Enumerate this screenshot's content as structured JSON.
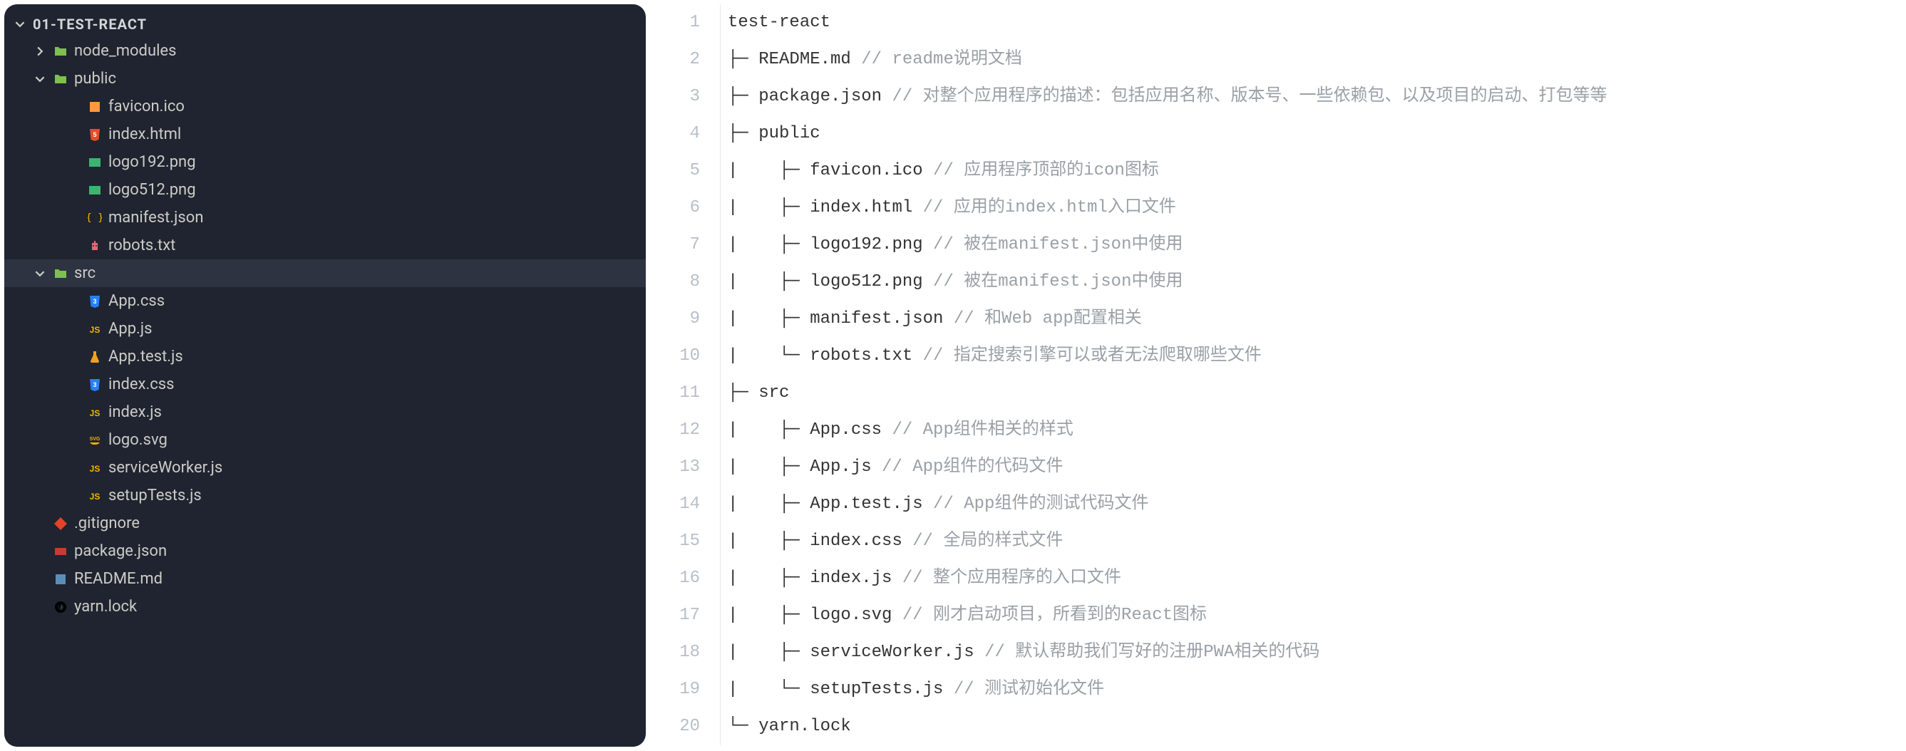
{
  "sidebar": {
    "root": "01-TEST-REACT",
    "tree": [
      {
        "id": "node_modules",
        "label": "node_modules",
        "depth": 1,
        "icon": "folder-green",
        "chevron": "right",
        "selected": false
      },
      {
        "id": "public",
        "label": "public",
        "depth": 1,
        "icon": "folder-green",
        "chevron": "down",
        "selected": false
      },
      {
        "id": "favicon",
        "label": "favicon.ico",
        "depth": 2,
        "icon": "orange",
        "chevron": "",
        "selected": false
      },
      {
        "id": "index-html",
        "label": "index.html",
        "depth": 2,
        "icon": "html",
        "chevron": "",
        "selected": false
      },
      {
        "id": "logo192",
        "label": "logo192.png",
        "depth": 2,
        "icon": "img",
        "chevron": "",
        "selected": false
      },
      {
        "id": "logo512",
        "label": "logo512.png",
        "depth": 2,
        "icon": "img",
        "chevron": "",
        "selected": false
      },
      {
        "id": "manifest",
        "label": "manifest.json",
        "depth": 2,
        "icon": "json",
        "chevron": "",
        "selected": false
      },
      {
        "id": "robots",
        "label": "robots.txt",
        "depth": 2,
        "icon": "robot",
        "chevron": "",
        "selected": false
      },
      {
        "id": "src",
        "label": "src",
        "depth": 1,
        "icon": "folder-green",
        "chevron": "down",
        "selected": true
      },
      {
        "id": "app-css",
        "label": "App.css",
        "depth": 2,
        "icon": "css",
        "chevron": "",
        "selected": false
      },
      {
        "id": "app-js",
        "label": "App.js",
        "depth": 2,
        "icon": "js",
        "chevron": "",
        "selected": false
      },
      {
        "id": "app-test",
        "label": "App.test.js",
        "depth": 2,
        "icon": "test",
        "chevron": "",
        "selected": false
      },
      {
        "id": "index-css",
        "label": "index.css",
        "depth": 2,
        "icon": "css",
        "chevron": "",
        "selected": false
      },
      {
        "id": "index-js",
        "label": "index.js",
        "depth": 2,
        "icon": "js",
        "chevron": "",
        "selected": false
      },
      {
        "id": "logo-svg",
        "label": "logo.svg",
        "depth": 2,
        "icon": "svg",
        "chevron": "",
        "selected": false
      },
      {
        "id": "sw",
        "label": "serviceWorker.js",
        "depth": 2,
        "icon": "js",
        "chevron": "",
        "selected": false
      },
      {
        "id": "setup",
        "label": "setupTests.js",
        "depth": 2,
        "icon": "js",
        "chevron": "",
        "selected": false
      },
      {
        "id": "gitignore",
        "label": ".gitignore",
        "depth": 1,
        "icon": "git",
        "chevron": "",
        "selected": false
      },
      {
        "id": "package",
        "label": "package.json",
        "depth": 1,
        "icon": "npm",
        "chevron": "",
        "selected": false
      },
      {
        "id": "readme",
        "label": "README.md",
        "depth": 1,
        "icon": "readme",
        "chevron": "",
        "selected": false
      },
      {
        "id": "yarn",
        "label": "yarn.lock",
        "depth": 1,
        "icon": "yarn",
        "chevron": "",
        "selected": false
      }
    ]
  },
  "code": {
    "lines": [
      {
        "n": 1,
        "text": "test-react",
        "comment": ""
      },
      {
        "n": 2,
        "text": "├─ README.md ",
        "comment": "// readme说明文档"
      },
      {
        "n": 3,
        "text": "├─ package.json ",
        "comment": "// 对整个应用程序的描述：包括应用名称、版本号、一些依赖包、以及项目的启动、打包等等"
      },
      {
        "n": 4,
        "text": "├─ public",
        "comment": ""
      },
      {
        "n": 5,
        "text": "|    ├─ favicon.ico ",
        "comment": "// 应用程序顶部的icon图标"
      },
      {
        "n": 6,
        "text": "|    ├─ index.html ",
        "comment": "// 应用的index.html入口文件"
      },
      {
        "n": 7,
        "text": "|    ├─ logo192.png ",
        "comment": "// 被在manifest.json中使用"
      },
      {
        "n": 8,
        "text": "|    ├─ logo512.png ",
        "comment": "// 被在manifest.json中使用"
      },
      {
        "n": 9,
        "text": "|    ├─ manifest.json ",
        "comment": "// 和Web app配置相关"
      },
      {
        "n": 10,
        "text": "|    └─ robots.txt ",
        "comment": "// 指定搜索引擎可以或者无法爬取哪些文件"
      },
      {
        "n": 11,
        "text": "├─ src",
        "comment": ""
      },
      {
        "n": 12,
        "text": "|    ├─ App.css ",
        "comment": "// App组件相关的样式"
      },
      {
        "n": 13,
        "text": "|    ├─ App.js ",
        "comment": "// App组件的代码文件"
      },
      {
        "n": 14,
        "text": "|    ├─ App.test.js ",
        "comment": "// App组件的测试代码文件"
      },
      {
        "n": 15,
        "text": "|    ├─ index.css ",
        "comment": "// 全局的样式文件"
      },
      {
        "n": 16,
        "text": "|    ├─ index.js ",
        "comment": "// 整个应用程序的入口文件"
      },
      {
        "n": 17,
        "text": "|    ├─ logo.svg ",
        "comment": "// 刚才启动项目，所看到的React图标"
      },
      {
        "n": 18,
        "text": "|    ├─ serviceWorker.js ",
        "comment": "// 默认帮助我们写好的注册PWA相关的代码"
      },
      {
        "n": 19,
        "text": "|    └─ setupTests.js ",
        "comment": "// 测试初始化文件"
      },
      {
        "n": 20,
        "text": "└─ yarn.lock",
        "comment": ""
      }
    ]
  }
}
